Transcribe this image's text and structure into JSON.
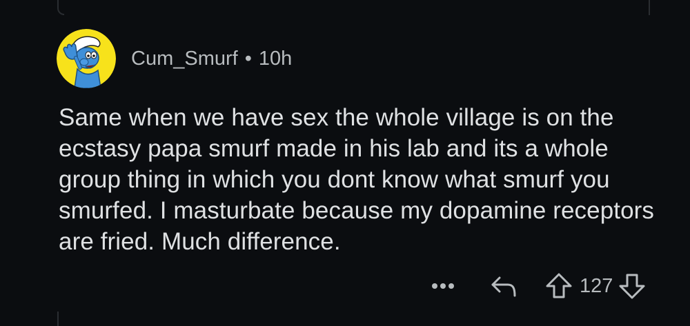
{
  "comment": {
    "author": "Cum_Smurf",
    "separator": "•",
    "age": "10h",
    "body": "Same when we have sex the whole village is on the ecstasy papa smurf made in his lab and its a whole group thing in which you dont know what smurf you smurfed. I masturbate because my dopamine receptors are fried. Much difference.",
    "score": "127"
  },
  "icons": {
    "avatar": "smurf-avatar",
    "more": "more-dots-icon",
    "reply": "reply-arrow-icon",
    "upvote": "upvote-arrow-icon",
    "downvote": "downvote-arrow-icon"
  },
  "colors": {
    "background": "#0b0d10",
    "avatar_background": "#f7e21b",
    "smurf_blue": "#3f8fd8",
    "meta_text": "#b8bcbf",
    "body_text": "#dfe1e3"
  }
}
